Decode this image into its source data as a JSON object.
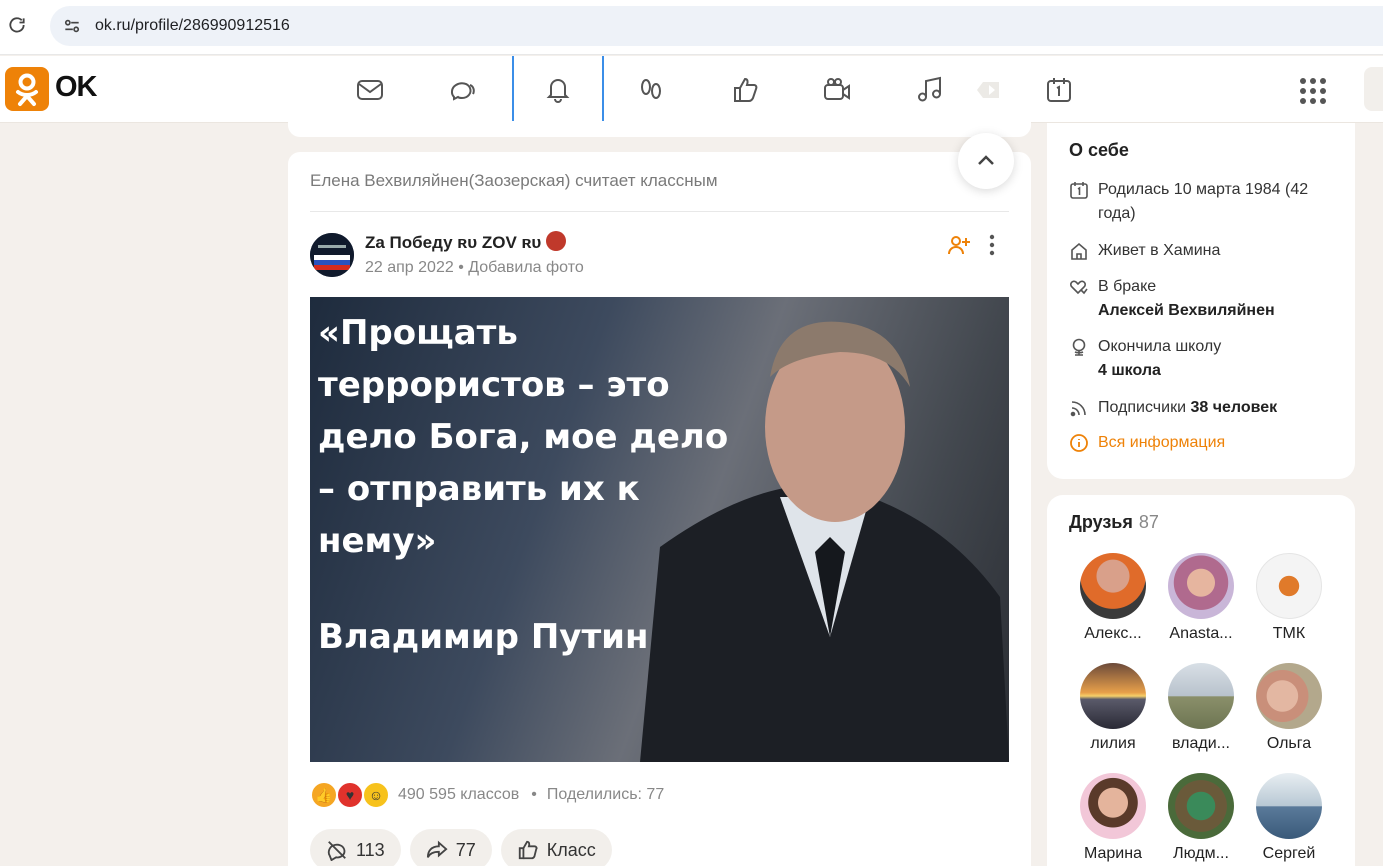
{
  "browser": {
    "url": "ok.ru/profile/286990912516"
  },
  "header": {
    "logo_text": "OK",
    "nav": [
      "messages-icon",
      "discussions-icon",
      "notifications-icon",
      "guests-icon",
      "marks-icon",
      "video-call-icon",
      "music-icon",
      "video-icon",
      "events-icon"
    ]
  },
  "feed": {
    "activity": "Елена Вехвиляйнен(Заозерская) считает классным",
    "author": "Zа Победу ʀᴜ ZOV ʀᴜ",
    "date": "22 апр 2022",
    "separator": "•",
    "action": "Добавила фото",
    "image_quote": "«Прощать\nтеррористов – это\nдело Бога, мое дело\n– отправить их к\nнему»",
    "image_author": "Владимир Путин",
    "likes": "490 595 классов",
    "shares_label": "Поделились: 77",
    "comments_count": "113",
    "reshare_count": "77",
    "class_label": "Класс"
  },
  "about": {
    "title": "О себе",
    "birth": "Родилась 10 марта 1984 (42 года)",
    "lives": "Живет в Хамина",
    "married_label": "В браке",
    "married_name": "Алексей Вехвиляйнен",
    "school_label": "Окончила школу",
    "school_name": "4 школа",
    "subs_label": "Подписчики",
    "subs_value": "38 человек",
    "all_info": "Вся информация"
  },
  "friends": {
    "title": "Друзья",
    "count": "87",
    "list": [
      "Алекс...",
      "Anasta...",
      "ТМК",
      "лилия",
      "влади...",
      "Ольга",
      "Марина",
      "Людм...",
      "Сергей"
    ]
  },
  "colors": {
    "accent": "#ee8208",
    "active_tab": "#3b8ee8"
  }
}
